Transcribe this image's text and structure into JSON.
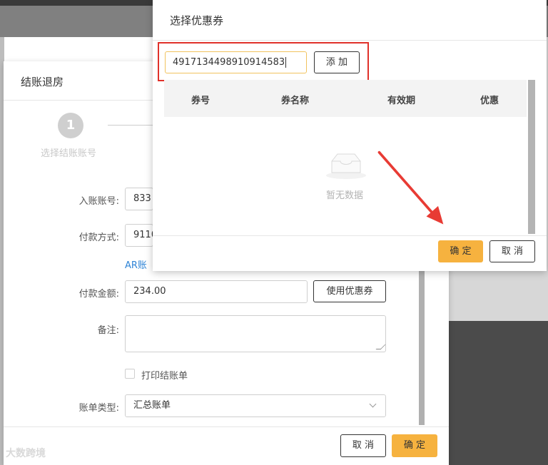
{
  "checkout": {
    "title": "结账退房",
    "step_number": "1",
    "step_label": "选择结账账号",
    "account_label": "入账账号:",
    "account_value": "833",
    "payment_label": "付款方式:",
    "payment_value": "9110",
    "ar_link": "AR账",
    "amount_label": "付款金额:",
    "amount_value": "234.00",
    "use_coupon_button": "使用优惠券",
    "remark_label": "备注:",
    "print_label": "打印结账单",
    "bill_type_label": "账单类型:",
    "bill_type_value": "汇总账单",
    "cancel_button": "取 消",
    "confirm_button": "确 定"
  },
  "coupon": {
    "title": "选择优惠券",
    "code_input_value": "4917134498910914583",
    "add_button": "添 加",
    "columns": [
      "券号",
      "券名称",
      "有效期",
      "优惠"
    ],
    "empty_text": "暂无数据",
    "confirm_button": "确 定",
    "cancel_button": "取 消"
  },
  "watermark": "大数跨境",
  "colors": {
    "accent_yellow": "#f6b23f",
    "highlight_red": "#e0312a",
    "link_blue": "#2f84d6"
  },
  "icons": [
    "empty-box-icon",
    "chevron-down-icon",
    "red-arrow-icon"
  ]
}
